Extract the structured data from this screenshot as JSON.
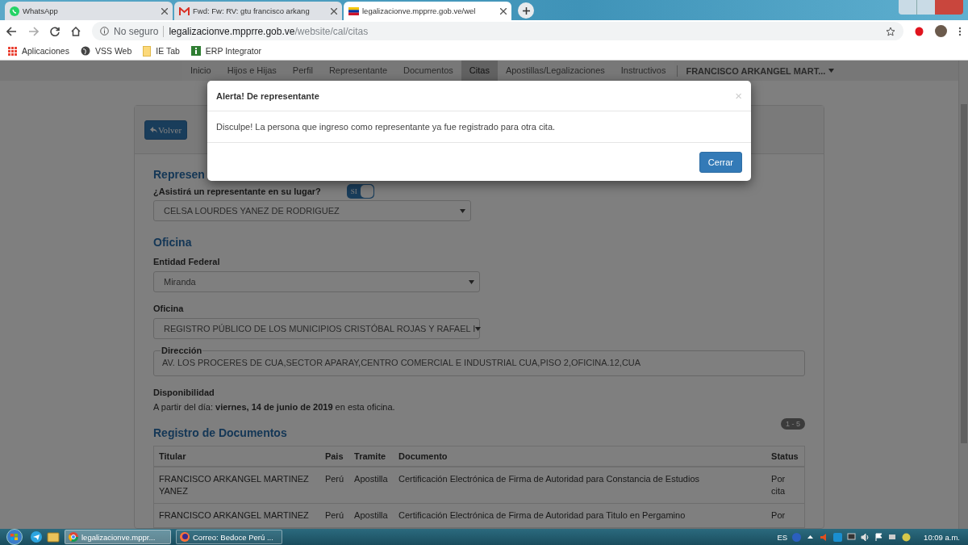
{
  "browser": {
    "tabs": [
      {
        "kind": "whatsapp",
        "title": "WhatsApp",
        "selected": false
      },
      {
        "kind": "mail",
        "title": "Fwd: Fw: RV: gtu francisco arkang",
        "selected": false
      },
      {
        "kind": "flag",
        "title": "legalizacionve.mpprre.gob.ve/wel",
        "selected": true
      }
    ],
    "security": "No seguro",
    "url": {
      "host": "legalizacionve.mpprre.gob.ve",
      "path": "/website/cal/citas"
    },
    "bookmarks": [
      {
        "kind": "apps",
        "label": "Aplicaciones"
      },
      {
        "kind": "globe",
        "label": "VSS Web"
      },
      {
        "kind": "folder",
        "label": "IE Tab"
      },
      {
        "kind": "info",
        "label": "ERP Integrator"
      }
    ]
  },
  "nav": {
    "items": [
      {
        "label": "Inicio",
        "selected": false
      },
      {
        "label": "Hijos e Hijas",
        "selected": false
      },
      {
        "label": "Perfil",
        "selected": false
      },
      {
        "label": "Representante",
        "selected": false
      },
      {
        "label": "Documentos",
        "selected": false
      },
      {
        "label": "Citas",
        "selected": true
      },
      {
        "label": "Apostillas/Legalizaciones",
        "selected": false
      },
      {
        "label": "Instructivos",
        "selected": false
      }
    ],
    "user": "FRANCISCO ARKANGEL MART..."
  },
  "back_button": "Volver",
  "representante": {
    "heading": "Represen",
    "question": "¿Asistirá un representante en su lugar?",
    "toggle": {
      "label": "SI",
      "on": true
    },
    "select": "CELSA LOURDES YANEZ DE RODRIGUEZ"
  },
  "oficina": {
    "heading": "Oficina",
    "entidad_label": "Entidad Federal",
    "entidad": "Miranda",
    "oficina_label": "Oficina",
    "oficina": "REGISTRO PÚBLICO DE LOS MUNICIPIOS CRISTÓBAL ROJAS Y RAFAEL I",
    "direccion_label": "Dirección",
    "direccion": "AV. LOS PROCERES DE CUA,SECTOR APARAY,CENTRO COMERCIAL E INDUSTRIAL CUA,PISO 2,OFICINA.12,CUA",
    "disponibilidad_label": "Disponibilidad",
    "disponibilidad": "A partir del día: **viernes, 14 de junio de 2019** en esta oficina."
  },
  "registro": {
    "heading": "Registro de Documentos",
    "badge": "1 - 5",
    "columns": [
      "Titular",
      "Pais",
      "Tramite",
      "Documento",
      "Status"
    ],
    "rows": [
      [
        "FRANCISCO ARKANGEL MARTINEZ YANEZ",
        "Perú",
        "Apostilla",
        "Certificación Electrónica de Firma de Autoridad para Constancia de Estudios",
        "Por cita"
      ],
      [
        "FRANCISCO ARKANGEL MARTINEZ",
        "Perú",
        "Apostilla",
        "Certificación Electrónica de Firma de Autoridad para Titulo en Pergamino",
        "Por"
      ]
    ]
  },
  "modal": {
    "title": "Alerta! De representante",
    "close": "×",
    "message": "Disculpe! La persona que ingreso como representante ya fue registrado para otra cita.",
    "button": "Cerrar"
  },
  "taskbar": {
    "windows": [
      {
        "kind": "chrome",
        "label": "legalizacionve.mppr...",
        "selected": true
      },
      {
        "kind": "firefox",
        "label": "Correo: Bedoce Perú ...",
        "selected": false
      }
    ],
    "language": "ES",
    "time": "10:09 a.m."
  }
}
